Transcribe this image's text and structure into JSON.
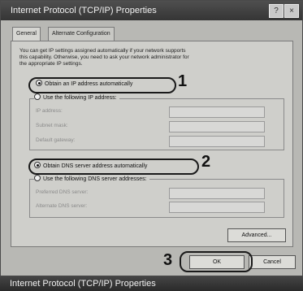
{
  "window": {
    "title": "Internet Protocol (TCP/IP) Properties",
    "help_button": "?",
    "close_button": "×"
  },
  "tabs": [
    {
      "label": "General",
      "active": true
    },
    {
      "label": "Alternate Configuration",
      "active": false
    }
  ],
  "intro_lines": [
    "You can get IP settings assigned automatically if your network supports",
    "this capability. Otherwise, you need to ask your network administrator for",
    "the appropriate IP settings."
  ],
  "ip": {
    "auto_label": "Obtain an IP address automatically",
    "manual_label": "Use the following IP address:",
    "selected": "auto",
    "fields": [
      {
        "label": "IP address:",
        "value": ""
      },
      {
        "label": "Subnet mask:",
        "value": ""
      },
      {
        "label": "Default gateway:",
        "value": ""
      }
    ]
  },
  "dns": {
    "auto_label": "Obtain DNS server address automatically",
    "manual_label": "Use the following DNS server addresses:",
    "selected": "auto",
    "fields": [
      {
        "label": "Preferred DNS server:",
        "value": ""
      },
      {
        "label": "Alternate DNS server:",
        "value": ""
      }
    ]
  },
  "buttons": {
    "advanced": "Advanced...",
    "ok": "OK",
    "cancel": "Cancel"
  },
  "callouts": {
    "one": "1",
    "two": "2",
    "three": "3"
  },
  "taskbar": {
    "label": "Internet Protocol (TCP/IP) Properties"
  },
  "colors": {
    "titlebar": "#3f3f3f",
    "dialog_bg": "#b8b8b4",
    "panel_bg": "#cfcfcb"
  }
}
